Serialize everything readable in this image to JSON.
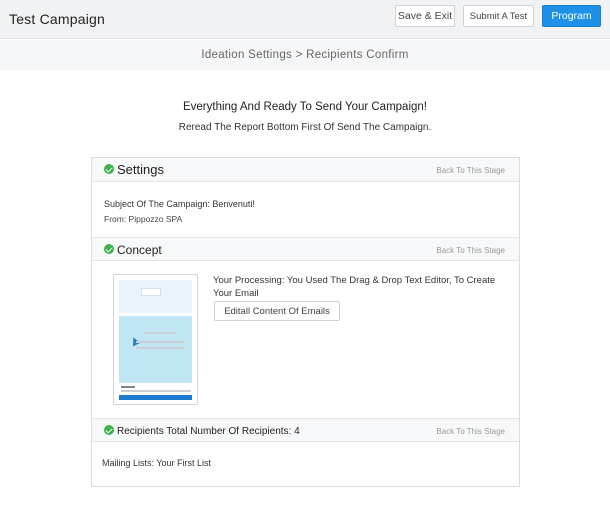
{
  "header": {
    "title": "Test Campaign",
    "save_exit": "Save & Exit",
    "submit_test": "Submit A Test",
    "program": "Program"
  },
  "breadcrumb": "Ideation Settings > Recipients Confirm",
  "intro": {
    "headline": "Everything And Ready To Send Your Campaign!",
    "subline": "Reread The Report Bottom First Of Send The Campaign."
  },
  "sections": {
    "settings": {
      "title": "Settings",
      "back": "Back To This Stage",
      "subject": "Subject Of The Campaign: Benvenuti!",
      "from": "From: Pippozzo SPA"
    },
    "concept": {
      "title": "Concept",
      "back": "Back To This Stage",
      "processing": "Your Processing: You Used The Drag & Drop Text Editor, To Create Your Email",
      "edit_button": "Editall Content Of Emails"
    },
    "recipients": {
      "title": "Recipients Total Number Of Recipients: 4",
      "back": "Back To This Stage",
      "mailing_lists": "Mailing Lists: Your First List"
    }
  },
  "colors": {
    "accent": "#1e90e8",
    "success": "#3cb34a"
  }
}
